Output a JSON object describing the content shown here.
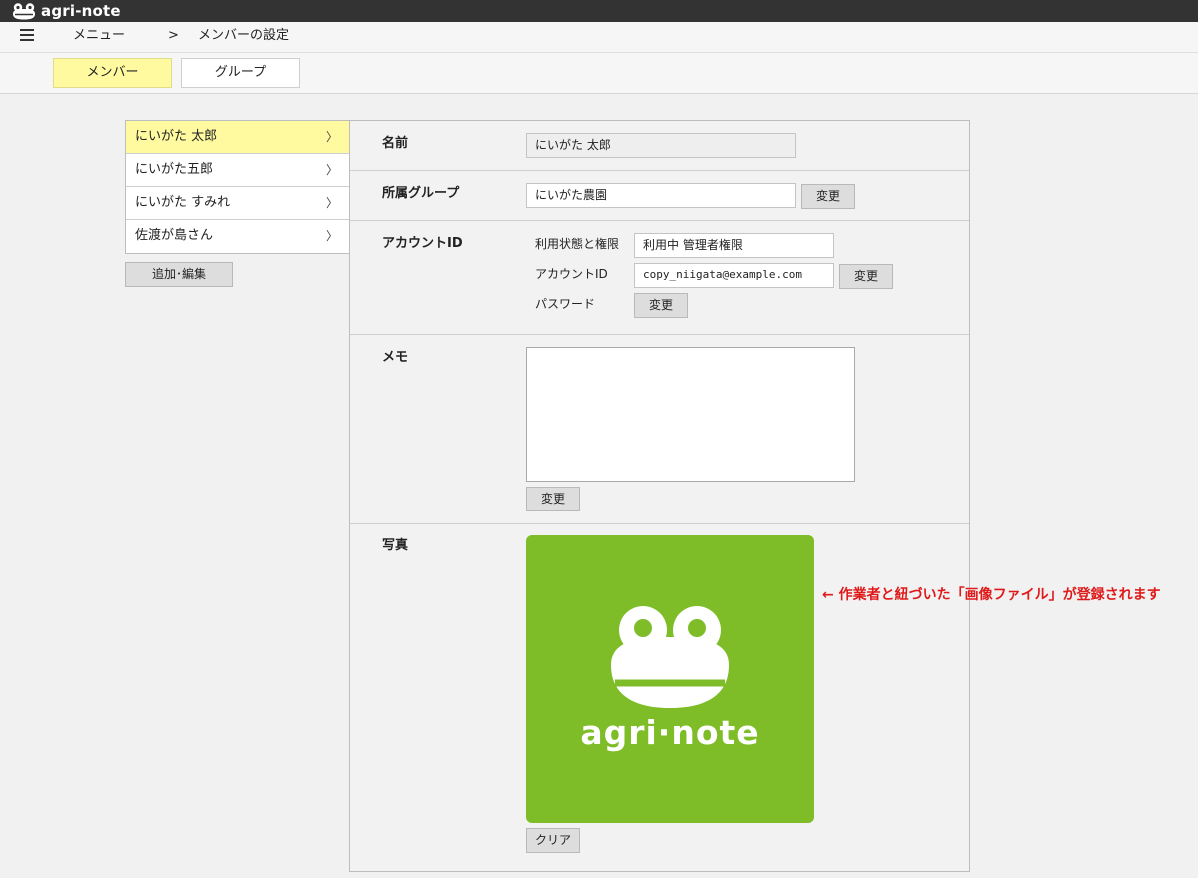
{
  "app": {
    "brand": "agri-note",
    "brand_logo_icon": "frog-logo-icon"
  },
  "nav": {
    "menu_icon": "hamburger-icon",
    "menu_label": "メニュー",
    "separator": ">",
    "current": "メンバーの設定"
  },
  "tabs": [
    {
      "label": "メンバー",
      "active": true
    },
    {
      "label": "グループ",
      "active": false
    }
  ],
  "members": [
    {
      "name": "にいがた 太郎",
      "chevron": "〉",
      "selected": true
    },
    {
      "name": "にいがた五郎",
      "chevron": "〉",
      "selected": false
    },
    {
      "name": "にいがた すみれ",
      "chevron": "〉",
      "selected": false
    },
    {
      "name": "佐渡が島さん",
      "chevron": "〉",
      "selected": false
    }
  ],
  "member_actions": {
    "add_edit_label": "追加･編集"
  },
  "detail": {
    "name": {
      "label": "名前",
      "value": "にいがた 太郎"
    },
    "group": {
      "label": "所属グループ",
      "value": "にいがた農園",
      "change_label": "変更"
    },
    "account": {
      "label": "アカウントID",
      "status_label": "利用状態と権限",
      "status_value": "利用中 管理者権限",
      "id_label": "アカウントID",
      "id_value": "copy_niigata@example.com",
      "id_change_label": "変更",
      "password_label": "パスワード",
      "password_change_label": "変更"
    },
    "memo": {
      "label": "メモ",
      "value": "",
      "change_label": "変更"
    },
    "photo": {
      "label": "写真",
      "image_text": "agri·note",
      "image_bg": "#7ebd27",
      "clear_label": "クリア"
    }
  },
  "annotation": {
    "text": "← 作業者と紐づいた「画像ファイル」が登録されます",
    "color": "#e01a1a"
  },
  "colors": {
    "topbar": "#333333",
    "highlight": "#fffaa0"
  }
}
